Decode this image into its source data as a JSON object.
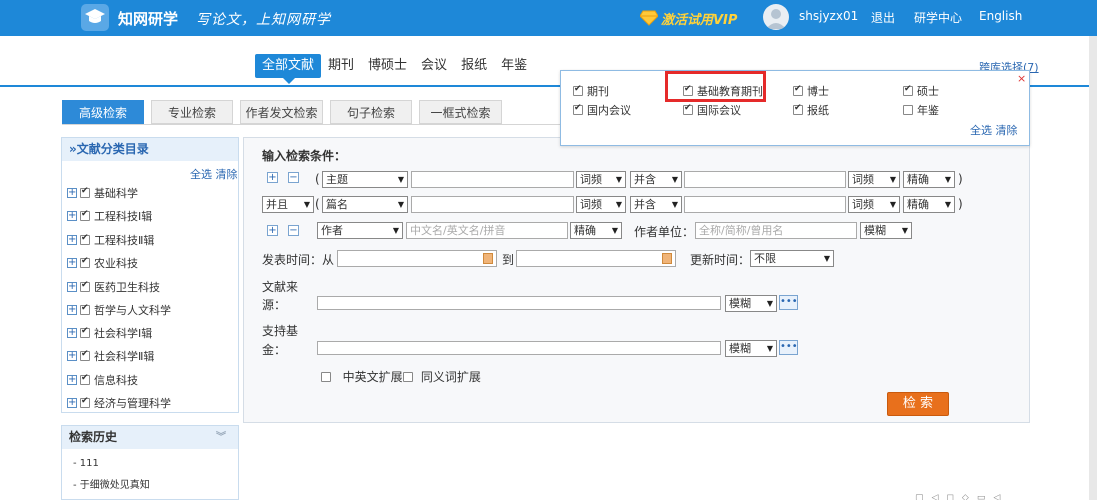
{
  "header": {
    "brand": "知网研学",
    "slogan": "写论文，上知网研学",
    "vip_label": "激活试用VIP",
    "username": "shsjyzx01",
    "logout": "退出",
    "center": "研学中心",
    "english": "English"
  },
  "type_tabs": [
    "全部文献",
    "期刊",
    "博硕士",
    "会议",
    "报纸",
    "年鉴"
  ],
  "cross_db": "跨库选择(7)",
  "popup": {
    "close": "×",
    "options": [
      {
        "label": "期刊",
        "checked": true
      },
      {
        "label": "基础教育期刊",
        "checked": true
      },
      {
        "label": "博士",
        "checked": true
      },
      {
        "label": "硕士",
        "checked": true
      },
      {
        "label": "国内会议",
        "checked": true
      },
      {
        "label": "国际会议",
        "checked": true
      },
      {
        "label": "报纸",
        "checked": true
      },
      {
        "label": "年鉴",
        "checked": false
      }
    ],
    "select_all": "全选",
    "clear": "清除"
  },
  "search_tabs": [
    "高级检索",
    "专业检索",
    "作者发文检索",
    "句子检索",
    "一框式检索"
  ],
  "sidebar": {
    "title": "»文献分类目录",
    "select_all": "全选",
    "clear": "清除",
    "items": [
      "基础科学",
      "工程科技Ⅰ辑",
      "工程科技Ⅱ辑",
      "农业科技",
      "医药卫生科技",
      "哲学与人文科学",
      "社会科学Ⅰ辑",
      "社会科学Ⅱ辑",
      "信息科技",
      "经济与管理科学"
    ]
  },
  "history": {
    "title": "检索历史",
    "items": [
      "111",
      "于细微处见真知"
    ]
  },
  "panel": {
    "title": "输入检索条件：",
    "row1": {
      "field": "主题",
      "freq": "词频",
      "logic": "并含",
      "freq2": "词频",
      "match": "精确"
    },
    "row2": {
      "bool": "并且",
      "field": "篇名",
      "freq": "词频",
      "logic": "并含",
      "freq2": "词频",
      "match": "精确"
    },
    "row3": {
      "field": "作者",
      "placeholder": "中文名/英文名/拼音",
      "match": "精确",
      "unit_label": "作者单位：",
      "unit_placeholder": "全称/简称/曾用名",
      "unit_match": "模糊"
    },
    "date_label": "发表时间：",
    "from": "从",
    "to": "到",
    "update_label": "更新时间：",
    "update_value": "不限",
    "source_label_1": "文献来",
    "source_label_2": "源：",
    "source_match": "模糊",
    "fund_label_1": "支持基",
    "fund_label_2": "金：",
    "fund_match": "模糊",
    "cn_en_expand": "中英文扩展",
    "synonym_expand": "同义词扩展",
    "search_button": "检 索"
  }
}
